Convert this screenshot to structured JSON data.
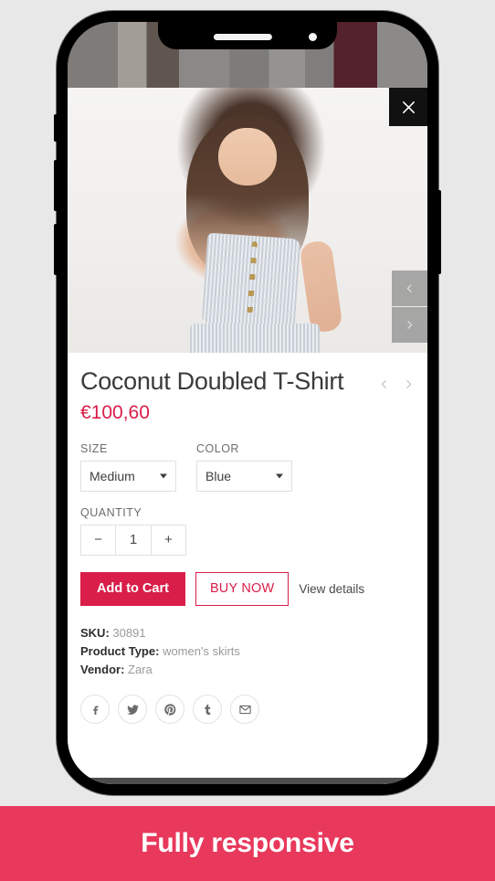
{
  "background_color": "#e8e8e8",
  "accent_color": "#d91e49",
  "banner": {
    "text": "Fully responsive",
    "background_color": "#e8385c"
  },
  "phone": {
    "notch": {
      "speaker_name": "speaker-grille",
      "camera_name": "front-camera"
    },
    "buttons": [
      "mute-switch",
      "volume-down",
      "volume-up",
      "power-button"
    ]
  },
  "modal": {
    "close_label": "×",
    "image": {
      "alt": "model wearing grey striped button-front crop top",
      "prev_label": "‹",
      "next_label": "›"
    },
    "product": {
      "title": "Coconut Doubled T-Shirt",
      "price": "€100,60",
      "prev_product_label": "‹",
      "next_product_label": "›"
    },
    "options": [
      {
        "label": "SIZE",
        "value": "Medium"
      },
      {
        "label": "COLOR",
        "value": "Blue"
      }
    ],
    "quantity": {
      "label": "QUANTITY",
      "value": "1",
      "decrement_label": "−",
      "increment_label": "+"
    },
    "actions": {
      "add_to_cart": "Add to Cart",
      "buy_now": "BUY NOW",
      "view_details": "View details"
    },
    "meta": [
      {
        "key": "SKU:",
        "value": "30891"
      },
      {
        "key": "Product Type:",
        "value": "women's skirts"
      },
      {
        "key": "Vendor:",
        "value": "Zara"
      }
    ],
    "socials": [
      {
        "name": "facebook-icon",
        "label": "f"
      },
      {
        "name": "twitter-icon",
        "label": "t"
      },
      {
        "name": "pinterest-icon",
        "label": "P"
      },
      {
        "name": "tumblr-icon",
        "label": "t"
      },
      {
        "name": "email-icon",
        "label": "✉"
      }
    ]
  }
}
